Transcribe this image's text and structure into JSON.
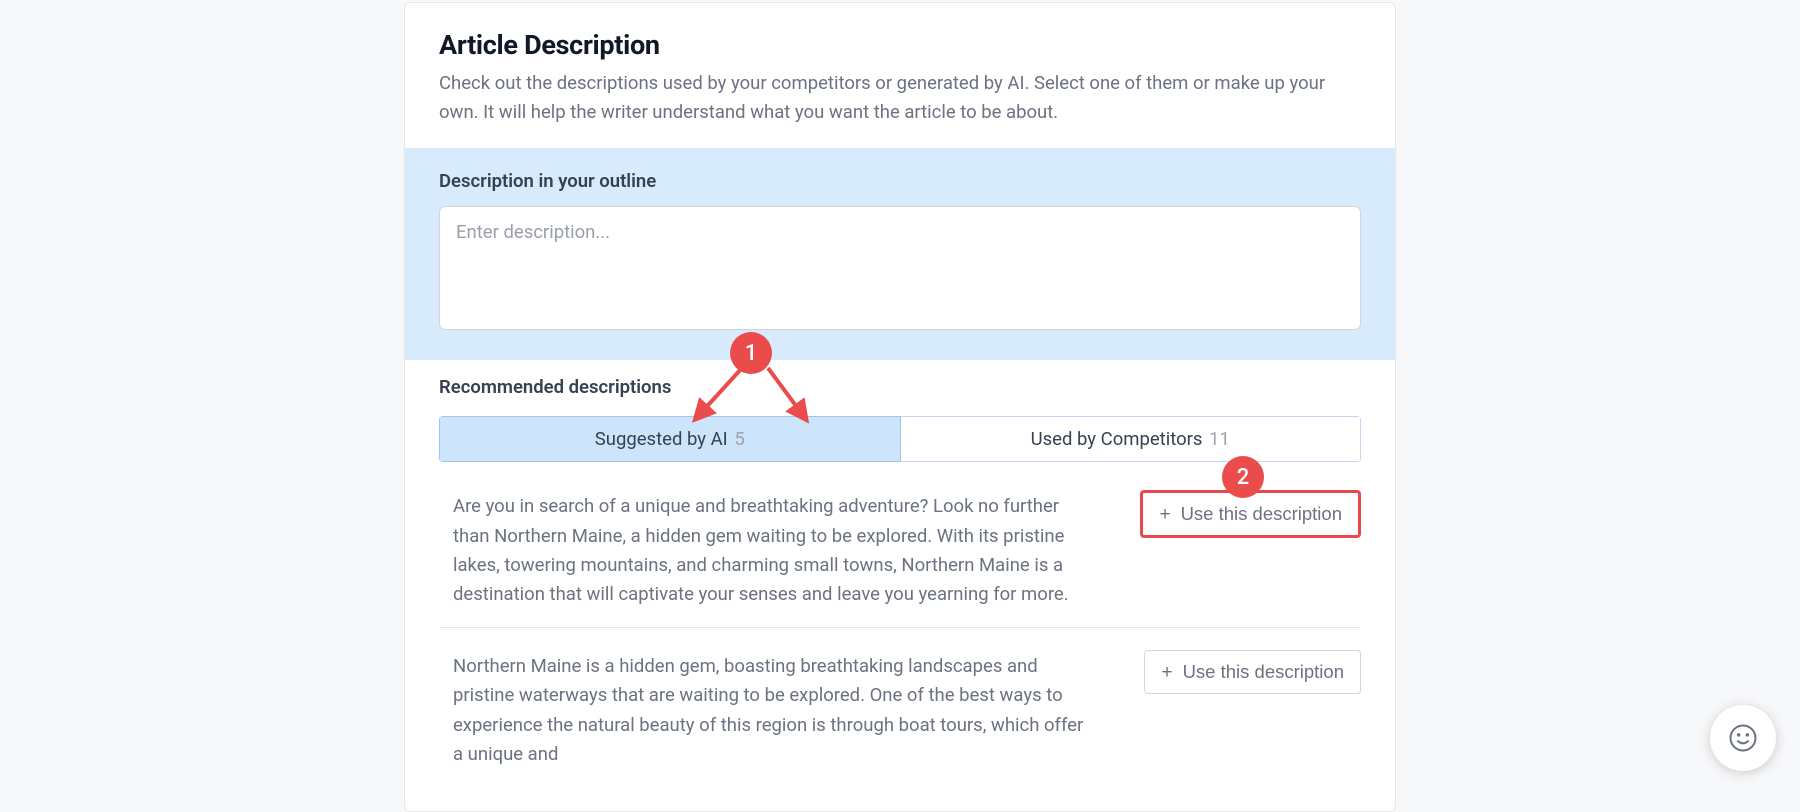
{
  "header": {
    "title": "Article Description",
    "subtitle": "Check out the descriptions used by your competitors or generated by AI. Select one of them or make up your own. It will help the writer understand what you want the article to be about."
  },
  "outline": {
    "label": "Description in your outline",
    "placeholder": "Enter description..."
  },
  "recommended": {
    "label": "Recommended descriptions",
    "tabs": {
      "ai": {
        "label": "Suggested by AI",
        "count": "5"
      },
      "competitors": {
        "label": "Used by Competitors",
        "count": "11"
      }
    },
    "useBtnLabel": "Use this description",
    "items": [
      {
        "text": "Are you in search of a unique and breathtaking adventure? Look no further than Northern Maine, a hidden gem waiting to be explored. With its pristine lakes, towering mountains, and charming small towns, Northern Maine is a destination that will captivate your senses and leave you yearning for more."
      },
      {
        "text": "Northern Maine is a hidden gem, boasting breathtaking landscapes and pristine waterways that are waiting to be explored. One of the best ways to experience the natural beauty of this region is through boat tours, which offer a unique and"
      }
    ]
  },
  "annotations": {
    "badge1": "1",
    "badge2": "2"
  }
}
